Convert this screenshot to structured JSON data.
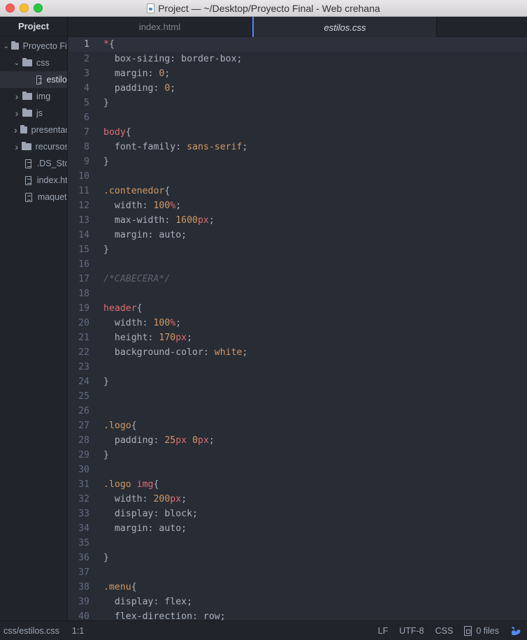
{
  "window": {
    "title": "Project — ~/Desktop/Proyecto Final - Web crehana"
  },
  "sidebar": {
    "header": "Project",
    "items": [
      {
        "label": "Proyecto Final",
        "type": "folder",
        "expanded": true,
        "depth": 0
      },
      {
        "label": "css",
        "type": "folder",
        "expanded": true,
        "depth": 1
      },
      {
        "label": "estilos.css",
        "type": "file",
        "depth": 2,
        "selected": true
      },
      {
        "label": "img",
        "type": "folder",
        "expanded": false,
        "depth": 1
      },
      {
        "label": "js",
        "type": "folder",
        "expanded": false,
        "depth": 1
      },
      {
        "label": "presentacion",
        "type": "folder",
        "expanded": false,
        "depth": 1
      },
      {
        "label": "recursos",
        "type": "folder",
        "expanded": false,
        "depth": 1
      },
      {
        "label": ".DS_Store",
        "type": "file",
        "depth": 1
      },
      {
        "label": "index.html",
        "type": "file",
        "depth": 1
      },
      {
        "label": "maqueta",
        "type": "file",
        "depth": 1
      }
    ]
  },
  "tabs": [
    {
      "label": "index.html",
      "active": false
    },
    {
      "label": "estilos.css",
      "active": true
    }
  ],
  "editor": {
    "cursor_line": 1,
    "lines": [
      [
        {
          "t": "*",
          "c": "sel"
        },
        {
          "t": "{",
          "c": "punc"
        }
      ],
      [
        {
          "t": "  box-sizing: border-box;",
          "c": "prop"
        }
      ],
      [
        {
          "t": "  margin: ",
          "c": "prop"
        },
        {
          "t": "0",
          "c": "num"
        },
        {
          "t": ";",
          "c": "punc"
        }
      ],
      [
        {
          "t": "  padding: ",
          "c": "prop"
        },
        {
          "t": "0",
          "c": "num"
        },
        {
          "t": ";",
          "c": "punc"
        }
      ],
      [
        {
          "t": "}",
          "c": "punc"
        }
      ],
      [],
      [
        {
          "t": "body",
          "c": "sel"
        },
        {
          "t": "{",
          "c": "punc"
        }
      ],
      [
        {
          "t": "  font-family: ",
          "c": "prop"
        },
        {
          "t": "sans-serif",
          "c": "val"
        },
        {
          "t": ";",
          "c": "punc"
        }
      ],
      [
        {
          "t": "}",
          "c": "punc"
        }
      ],
      [],
      [
        {
          "t": ".contenedor",
          "c": "cls"
        },
        {
          "t": "{",
          "c": "punc"
        }
      ],
      [
        {
          "t": "  width: ",
          "c": "prop"
        },
        {
          "t": "100",
          "c": "num"
        },
        {
          "t": "%",
          "c": "unit"
        },
        {
          "t": ";",
          "c": "punc"
        }
      ],
      [
        {
          "t": "  max-width: ",
          "c": "prop"
        },
        {
          "t": "1600",
          "c": "num"
        },
        {
          "t": "px",
          "c": "unit"
        },
        {
          "t": ";",
          "c": "punc"
        }
      ],
      [
        {
          "t": "  margin: auto;",
          "c": "prop"
        }
      ],
      [
        {
          "t": "}",
          "c": "punc"
        }
      ],
      [],
      [
        {
          "t": "/*CABECERA*/",
          "c": "cmt"
        }
      ],
      [],
      [
        {
          "t": "header",
          "c": "sel"
        },
        {
          "t": "{",
          "c": "punc"
        }
      ],
      [
        {
          "t": "  width: ",
          "c": "prop"
        },
        {
          "t": "100",
          "c": "num"
        },
        {
          "t": "%",
          "c": "unit"
        },
        {
          "t": ";",
          "c": "punc"
        }
      ],
      [
        {
          "t": "  height: ",
          "c": "prop"
        },
        {
          "t": "170",
          "c": "num"
        },
        {
          "t": "px",
          "c": "unit"
        },
        {
          "t": ";",
          "c": "punc"
        }
      ],
      [
        {
          "t": "  background-color: ",
          "c": "prop"
        },
        {
          "t": "white",
          "c": "val"
        },
        {
          "t": ";",
          "c": "punc"
        }
      ],
      [],
      [
        {
          "t": "}",
          "c": "punc"
        }
      ],
      [],
      [],
      [
        {
          "t": ".logo",
          "c": "cls"
        },
        {
          "t": "{",
          "c": "punc"
        }
      ],
      [
        {
          "t": "  padding: ",
          "c": "prop"
        },
        {
          "t": "25",
          "c": "num"
        },
        {
          "t": "px",
          "c": "unit"
        },
        {
          "t": " ",
          "c": "punc"
        },
        {
          "t": "0",
          "c": "num"
        },
        {
          "t": "px",
          "c": "unit"
        },
        {
          "t": ";",
          "c": "punc"
        }
      ],
      [
        {
          "t": "}",
          "c": "punc"
        }
      ],
      [],
      [
        {
          "t": ".logo",
          "c": "cls"
        },
        {
          "t": " ",
          "c": "punc"
        },
        {
          "t": "img",
          "c": "sel"
        },
        {
          "t": "{",
          "c": "punc"
        }
      ],
      [
        {
          "t": "  width: ",
          "c": "prop"
        },
        {
          "t": "200",
          "c": "num"
        },
        {
          "t": "px",
          "c": "unit"
        },
        {
          "t": ";",
          "c": "punc"
        }
      ],
      [
        {
          "t": "  display: block;",
          "c": "prop"
        }
      ],
      [
        {
          "t": "  margin: auto;",
          "c": "prop"
        }
      ],
      [],
      [
        {
          "t": "}",
          "c": "punc"
        }
      ],
      [],
      [
        {
          "t": ".menu",
          "c": "cls"
        },
        {
          "t": "{",
          "c": "punc"
        }
      ],
      [
        {
          "t": "  display: flex;",
          "c": "prop"
        }
      ],
      [
        {
          "t": "  flex-direction: row;",
          "c": "prop"
        }
      ]
    ]
  },
  "statusbar": {
    "file_path": "css/estilos.css",
    "cursor_position": "1:1",
    "line_ending": "LF",
    "encoding": "UTF-8",
    "grammar": "CSS",
    "git_files": "0 files"
  },
  "colors": {
    "background": "#282c34",
    "sidebar": "#21252b",
    "selector": "#e06c75",
    "number": "#d19a66",
    "comment": "#5c6370",
    "text": "#abb2bf",
    "accent": "#568af2"
  }
}
